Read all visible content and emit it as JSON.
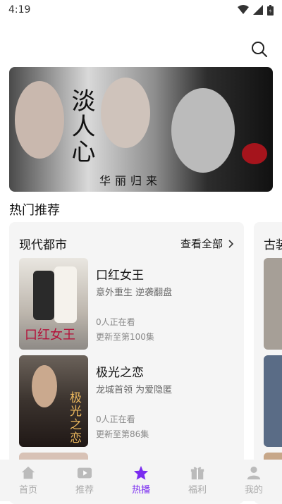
{
  "status": {
    "time": "4:19"
  },
  "banner": {
    "title": "淡人心",
    "subtitle": "华丽归来"
  },
  "section": {
    "title": "热门推荐"
  },
  "cards": [
    {
      "title": "现代都市",
      "see_all": "查看全部",
      "books": [
        {
          "title": "口红女王",
          "desc": "意外重生 逆袭翻盘",
          "viewers": "0人正在看",
          "update": "更新至第100集",
          "cover_text": "口红女王"
        },
        {
          "title": "极光之恋",
          "desc": "龙城首领 为爱隐匿",
          "viewers": "0人正在看",
          "update": "更新至第86集",
          "cover_text": "极光之恋"
        }
      ]
    },
    {
      "title": "古装"
    }
  ],
  "tabs": [
    {
      "label": "首页",
      "icon": "home-icon"
    },
    {
      "label": "推荐",
      "icon": "play-icon"
    },
    {
      "label": "热播",
      "icon": "star-icon",
      "active": true
    },
    {
      "label": "福利",
      "icon": "gift-icon"
    },
    {
      "label": "我的",
      "icon": "user-icon"
    }
  ],
  "colors": {
    "accent": "#7a2cf0",
    "card_bg": "#f5f5f5",
    "tab_bg": "#f4f4f4"
  }
}
